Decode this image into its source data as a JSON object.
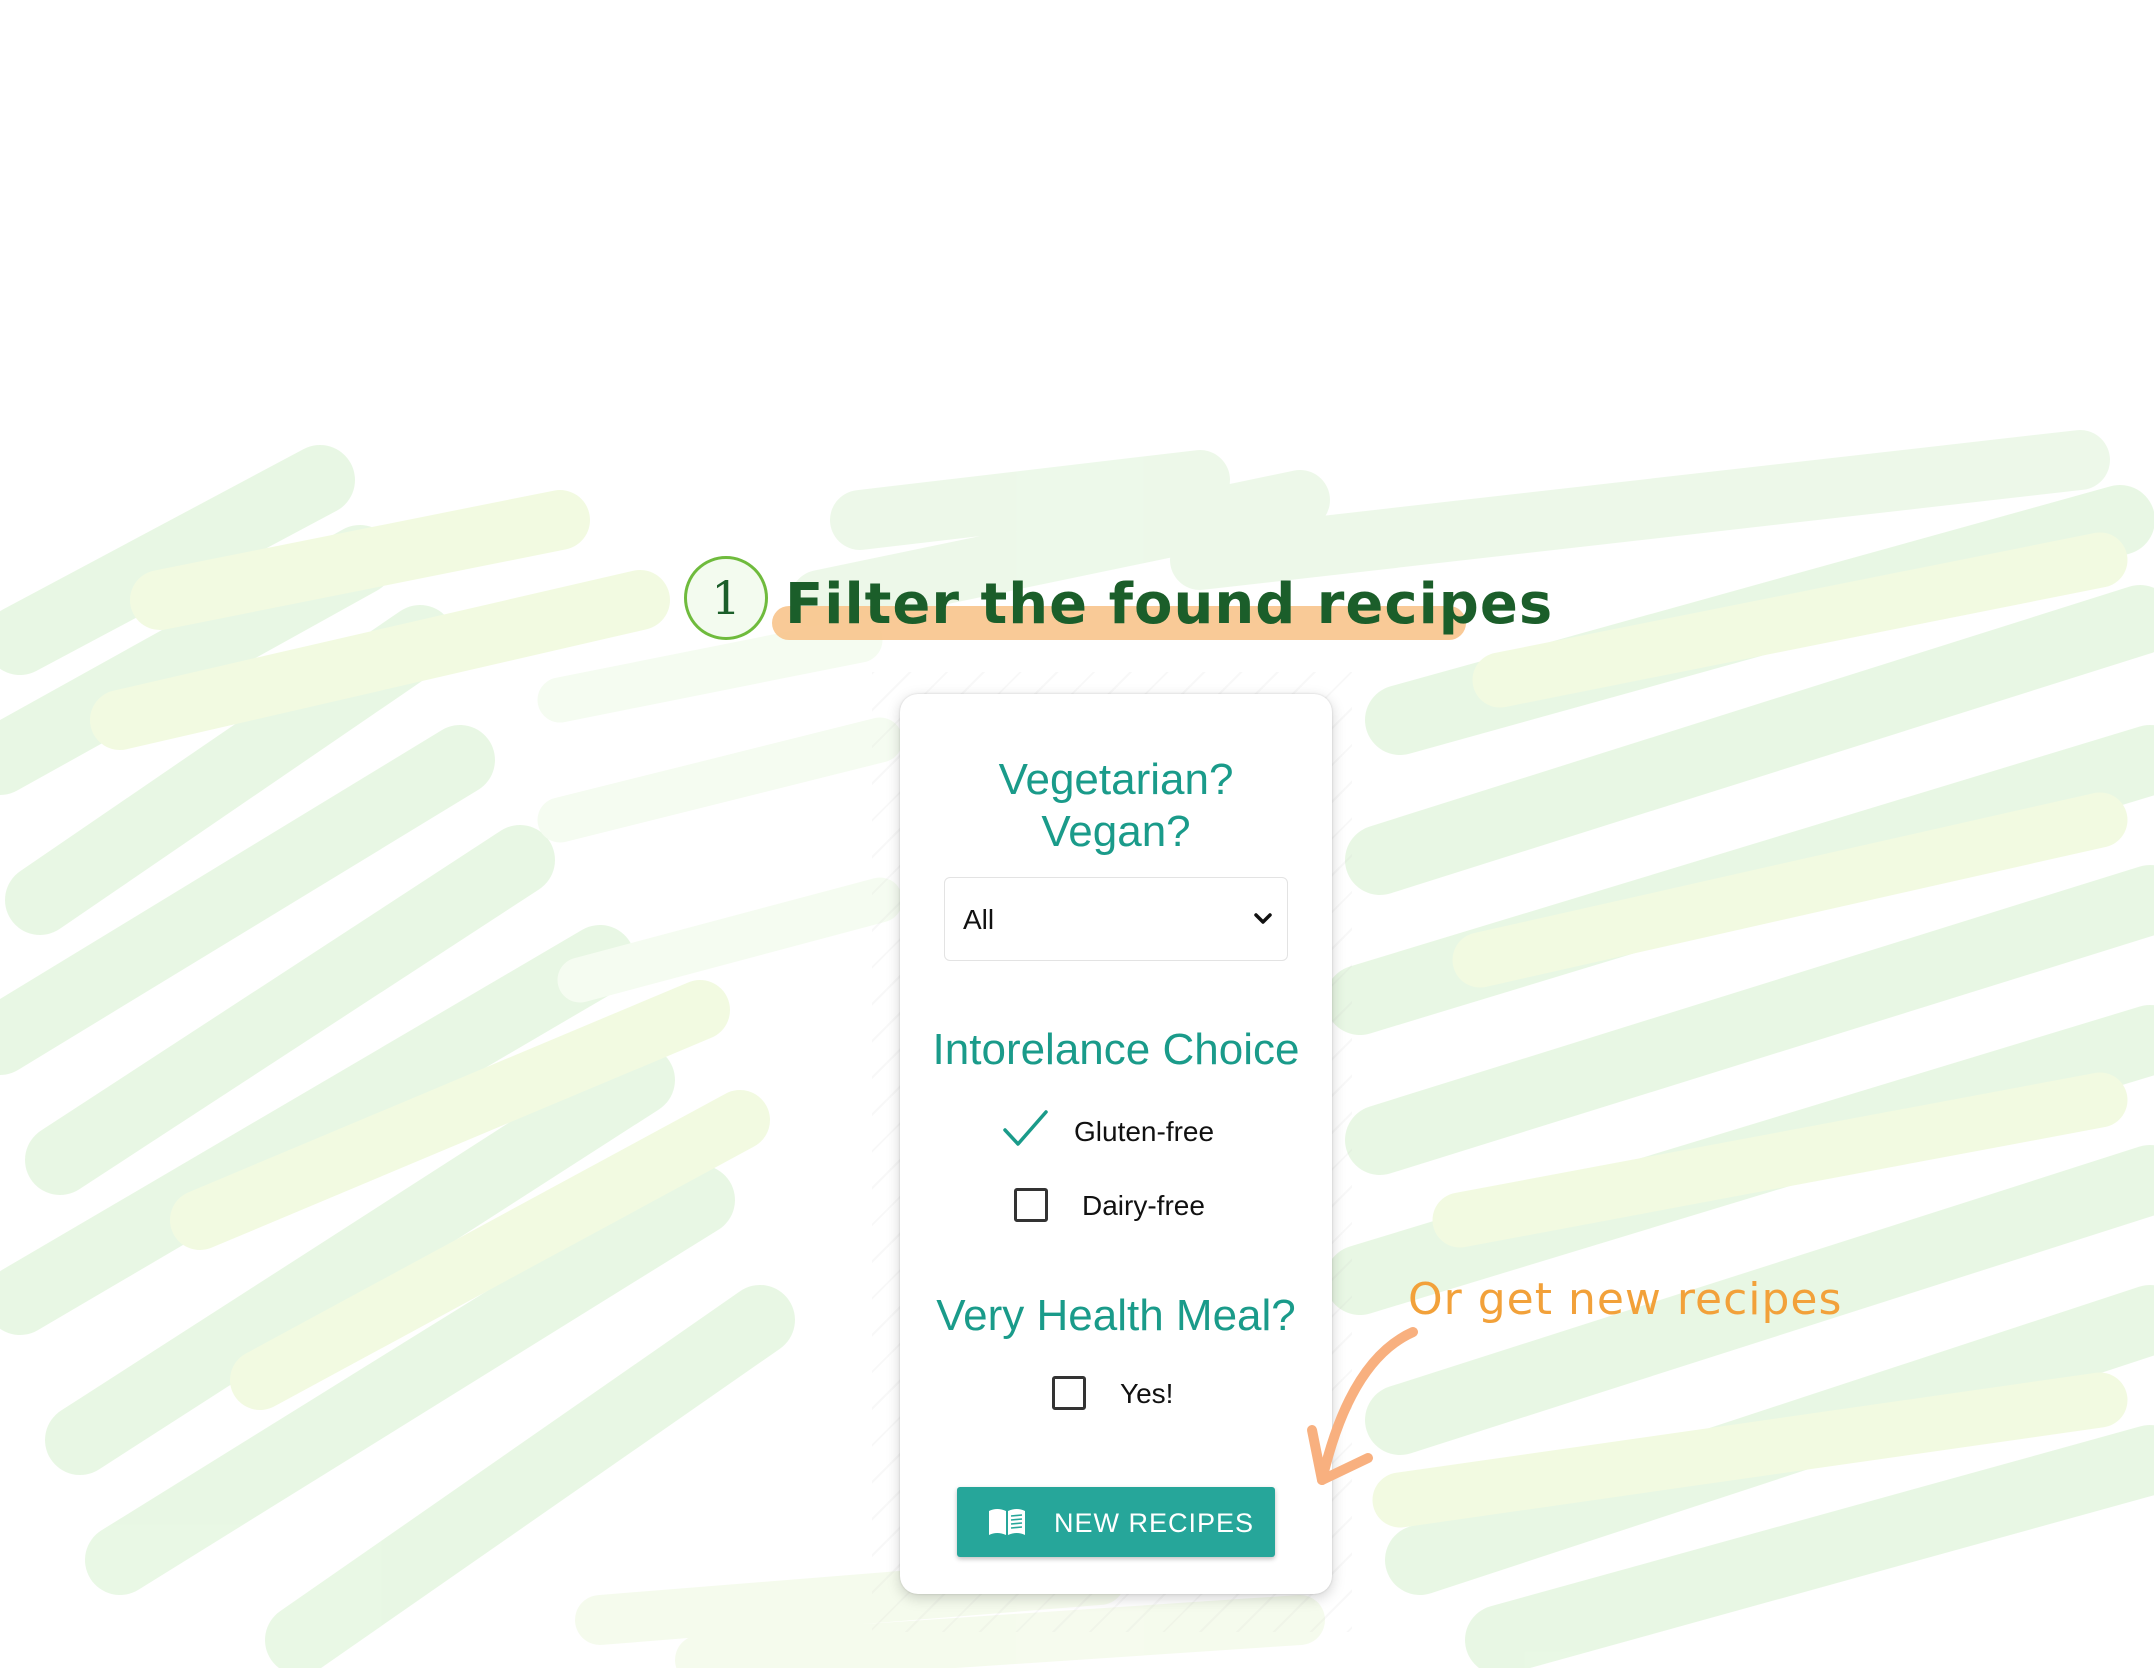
{
  "step": {
    "number": "1",
    "title": "Filter the found recipes"
  },
  "card": {
    "diet_title_line1": "Vegetarian?",
    "diet_title_line2": "Vegan?",
    "diet_select": {
      "value": "All"
    },
    "intolerance_title": "Intorelance Choice",
    "intolerance_options": [
      {
        "label": "Gluten-free",
        "checked": true
      },
      {
        "label": "Dairy-free",
        "checked": false
      }
    ],
    "health_title": "Very Health Meal?",
    "health_option": {
      "label": "Yes!",
      "checked": false
    },
    "button": {
      "label": "NEW RECIPES",
      "icon": "open-book-icon"
    }
  },
  "annotation": {
    "text": "Or get new recipes",
    "icon": "curved-arrow-icon"
  },
  "colors": {
    "accent_teal": "#26a69a",
    "title_teal": "#1a9b8a",
    "heading_green": "#1b5e2a",
    "highlight_orange": "#f8c48c",
    "annotation_orange": "#f2a13a"
  }
}
